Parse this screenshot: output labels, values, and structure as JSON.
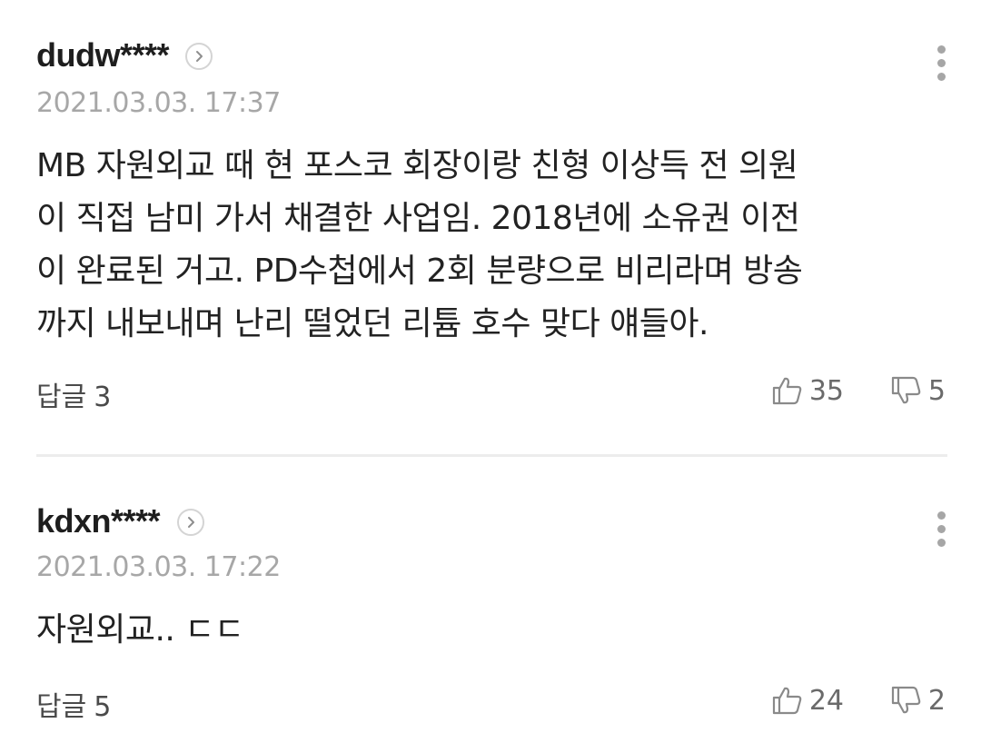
{
  "comments": [
    {
      "username": "dudw****",
      "date": "2021.03.03. 17:37",
      "body_lines": [
        "MB 자원외교 때 현 포스코 회장이랑 친형 이상득 전 의원",
        "이 직접 남미 가서 채결한 사업임. 2018년에 소유권 이전",
        "이 완료된 거고. PD수첩에서 2회 분량으로 비리라며 방송",
        "까지 내보내며 난리 떨었던 리튬 호수 맞다 얘들아."
      ],
      "reply_label": "답글",
      "reply_count": "3",
      "likes": "35",
      "dislikes": "5"
    },
    {
      "username": "kdxn****",
      "date": "2021.03.03. 17:22",
      "body_lines": [
        "자원외교.. ㄷㄷ"
      ],
      "reply_label": "답글",
      "reply_count": "5",
      "likes": "24",
      "dislikes": "2"
    }
  ],
  "icons": {
    "profile_arrow": "chevron-right-icon",
    "more": "more-vertical-icon",
    "like": "thumbs-up-icon",
    "dislike": "thumbs-down-icon"
  },
  "colors": {
    "username": "#1e1e1e",
    "body_text": "#222222",
    "date": "#a7a7a7",
    "icon_gray": "#a6a6a6",
    "divider": "#ececec"
  }
}
